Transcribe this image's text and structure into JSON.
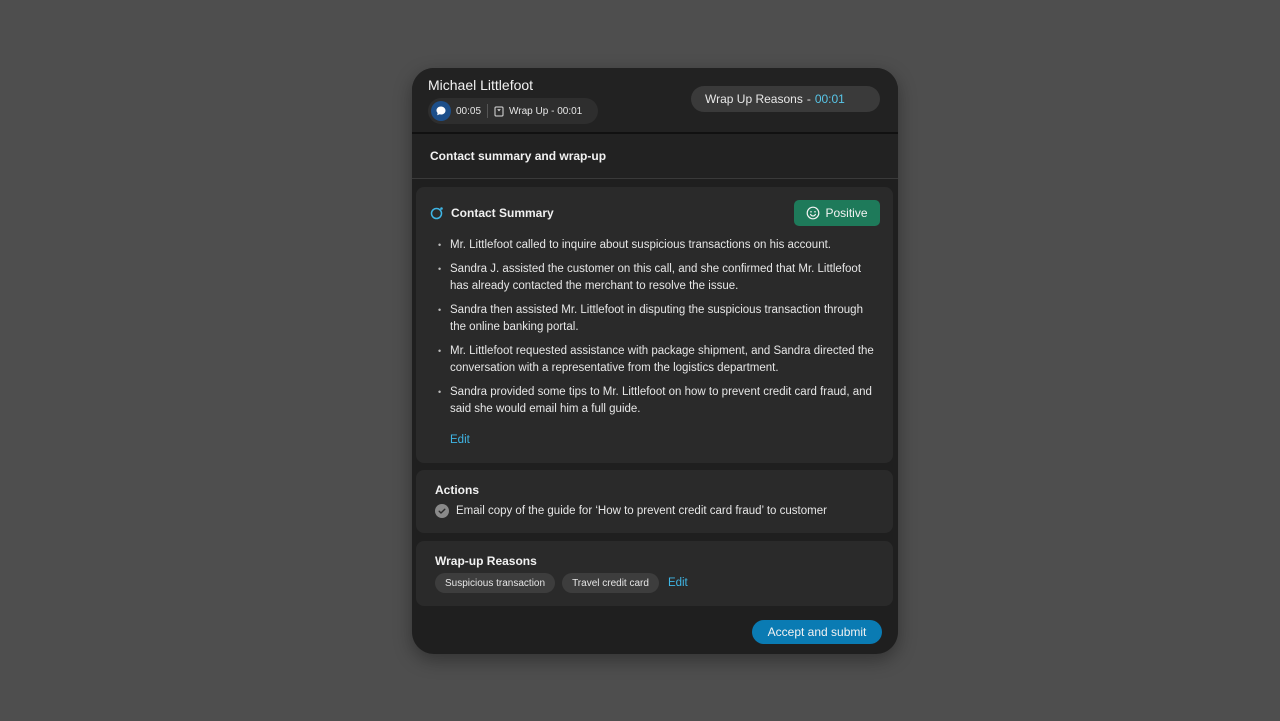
{
  "header": {
    "customer_name": "Michael Littlefoot",
    "chat_time": "00:05",
    "wrap_label": "Wrap Up - 00:01",
    "wrap_reasons_label": "Wrap Up Reasons",
    "wrap_reasons_sep": "-",
    "wrap_reasons_timer": "00:01"
  },
  "title": "Contact summary and wrap-up",
  "summary": {
    "heading": "Contact Summary",
    "sentiment": "Positive",
    "bullets": [
      "Mr. Littlefoot called to inquire about suspicious transactions on his account.",
      "Sandra J. assisted the customer on this call, and she confirmed that Mr. Littlefoot has already contacted the merchant to resolve the issue.",
      "Sandra then assisted Mr. Littlefoot in disputing the suspicious transaction through the online banking portal.",
      "Mr. Littlefoot requested assistance with package shipment, and Sandra directed the conversation with a representative from the logistics department.",
      "Sandra provided some tips to Mr. Littlefoot on how to prevent credit card fraud, and said she would email him a full guide."
    ],
    "edit_label": "Edit"
  },
  "actions": {
    "heading": "Actions",
    "item": "Email copy of the guide for ‘How to prevent credit card fraud’ to customer"
  },
  "wrapup": {
    "heading": "Wrap-up Reasons",
    "chips": [
      "Suspicious transaction",
      "Travel credit card"
    ],
    "edit_label": "Edit"
  },
  "submit_label": "Accept and submit",
  "colors": {
    "accent": "#3fb6e6",
    "positive": "#1e7a5a",
    "button": "#0a7bb3"
  }
}
